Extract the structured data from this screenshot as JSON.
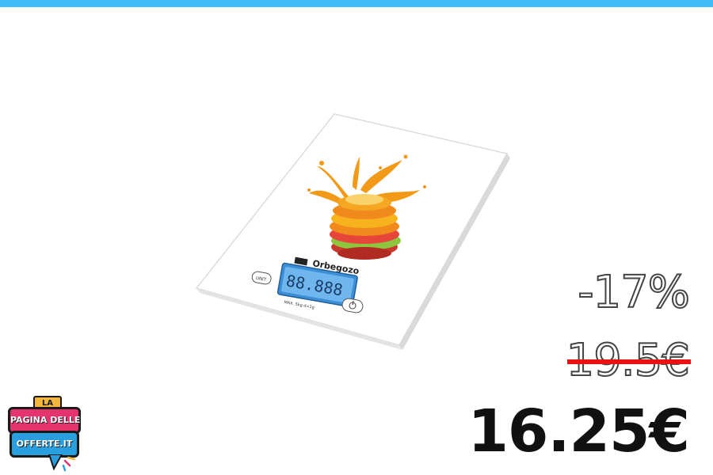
{
  "banner": {
    "accent_color": "#3fbdf7"
  },
  "product": {
    "image_icon": "kitchen-scale-image",
    "brand": "Orbegozo",
    "display_digits": "88.888",
    "unit_button": "UNIT",
    "max_text": "MAX. 5kg d=1g"
  },
  "pricing": {
    "discount": "-17%",
    "old_price": "19.5€",
    "new_price": "16.25€",
    "strike_color": "#e81212"
  },
  "logo": {
    "la": "LA",
    "line1": "PAGINA DELLE",
    "line2": "OFFERTE.IT"
  }
}
